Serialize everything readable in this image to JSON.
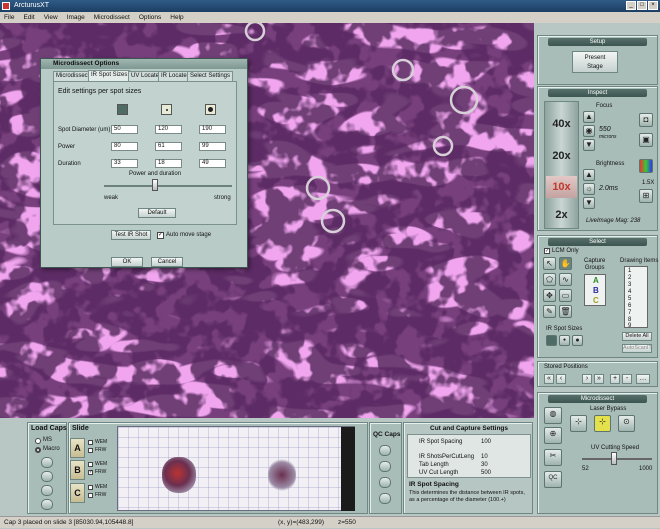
{
  "app": {
    "title": "ArcturusXT"
  },
  "menu": [
    "File",
    "Edit",
    "View",
    "Image",
    "Microdissect",
    "Options",
    "Help"
  ],
  "dialog": {
    "title": "Microdissect Options",
    "tabs": [
      "Microdissect",
      "IR Spot Sizes",
      "UV Locate",
      "IR Locate",
      "Select Settings"
    ],
    "heading": "Edit settings per spot sizes",
    "rows": [
      {
        "label": "Spot Diameter (um)",
        "values": [
          "50",
          "120",
          "190"
        ]
      },
      {
        "label": "Power",
        "values": [
          "80",
          "61",
          "99"
        ]
      },
      {
        "label": "Duration",
        "values": [
          "33",
          "18",
          "49"
        ]
      }
    ],
    "slider_title": "Power and duration",
    "weak": "weak",
    "strong": "strong",
    "default_btn": "Default",
    "test_btn": "Test IR Shot",
    "auto_move": "Auto move stage",
    "ok": "OK",
    "cancel": "Cancel"
  },
  "setup": {
    "title": "Setup",
    "present_btn": "Present\nStage"
  },
  "inspect": {
    "title": "Inspect",
    "mags": [
      "40x",
      "20x",
      "10x",
      "2x"
    ],
    "focus_label": "Focus",
    "focus_value": "550",
    "focus_unit": "microns",
    "brightness_label": "Brightness",
    "brightness_value": "2.0ms",
    "ratio": "1.5X",
    "livemag": "LiveImage Mag: 238"
  },
  "select": {
    "title": "Select",
    "lcm_only": "LCM Only",
    "capture_groups": "Capture\nGroups",
    "group_letters": [
      "A",
      "B",
      "C"
    ],
    "drawing_items": "Drawing Items",
    "item_numbers": [
      "1",
      "2",
      "3",
      "4",
      "5",
      "6",
      "7",
      "8",
      "9"
    ],
    "delete_all": "Delete All",
    "autoscan": "AutoScanIT",
    "ir_spot_sizes": "IR Spot Sizes"
  },
  "stored": {
    "title": "Stored Positions",
    "buttons": [
      "«",
      "‹",
      "›",
      "»",
      "+",
      "-",
      "…"
    ]
  },
  "microdissect": {
    "title": "Microdissect",
    "laser_bypass": "Laser Bypass",
    "uv_speed": "UV Cutting Speed",
    "speed_min": "52",
    "speed_max": "1000",
    "qc_btn": "QC"
  },
  "loadcaps": {
    "title": "Load Caps",
    "options": [
      "MS",
      "Macro"
    ]
  },
  "slide": {
    "title": "Slide",
    "letters": [
      "A",
      "B",
      "C"
    ],
    "wem": "WEM",
    "frw": "FRW"
  },
  "qccaps": {
    "title": "QC Caps"
  },
  "cut": {
    "title": "Cut and Capture Settings",
    "rows": [
      {
        "label": "IR Spot Spacing",
        "value": "100"
      },
      {
        "label": "IR ShotsPerCutLeng",
        "value": "10"
      },
      {
        "label": "Tab Length",
        "value": "30"
      },
      {
        "label": "UV Cut Length",
        "value": "500"
      }
    ],
    "desc_title": "IR Spot Spacing",
    "desc": "This determines the distance between IR spots, as a percentage of the diameter (100.+)"
  },
  "status": {
    "left": "Cap 3 placed on slide 3 [85030.94,105448.8]",
    "coords": "(x, y)=(483,299)",
    "z": "z=550"
  },
  "colors": {
    "tissue": "#f0a5ee",
    "stain": "#2a0c2e",
    "panel": "#a9bdb8"
  }
}
